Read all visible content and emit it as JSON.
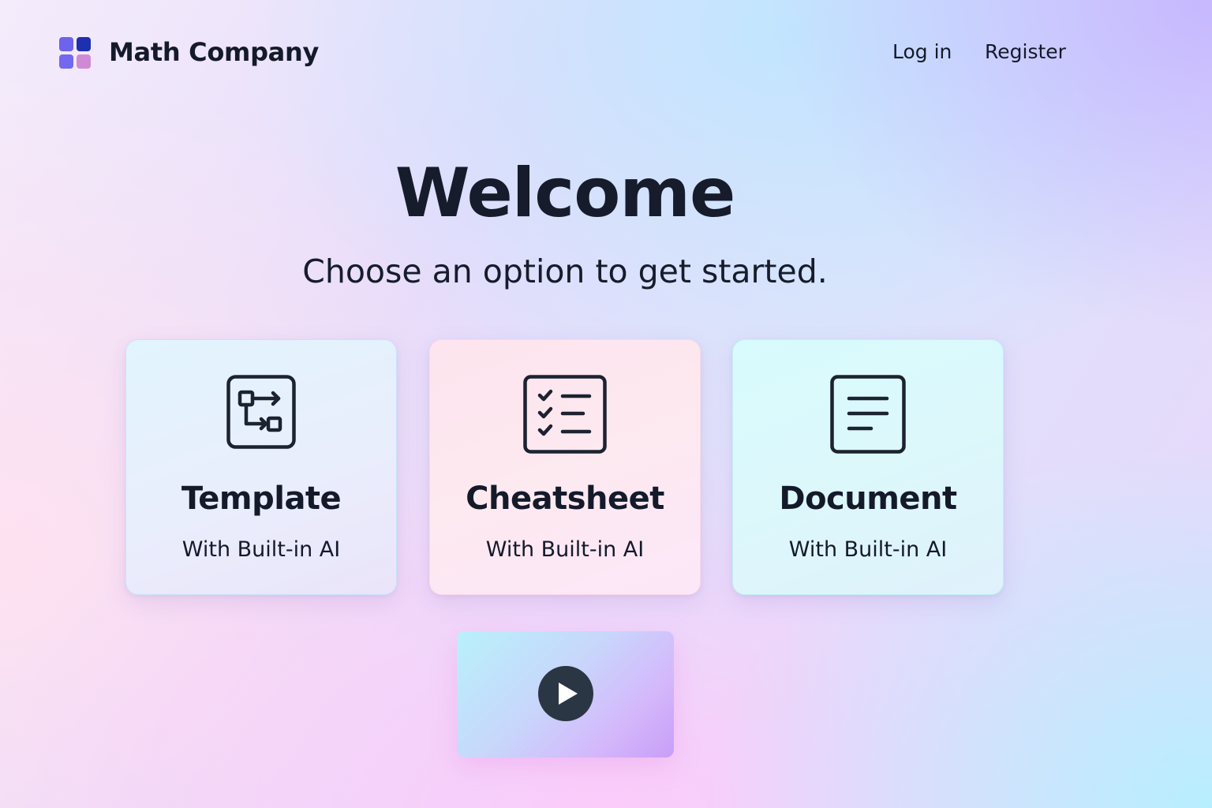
{
  "header": {
    "brand": "Math Company",
    "logo_icon": "grid-logo-icon",
    "logo_colors": [
      "#6d63ec",
      "#1e2fb0",
      "#7368ef",
      "#cf8ad6"
    ],
    "nav": {
      "login": "Log in",
      "register": "Register"
    }
  },
  "hero": {
    "title": "Welcome",
    "subtitle": "Choose an option to get started."
  },
  "cards": [
    {
      "title": "Template",
      "subtitle": "With Built-in AI",
      "icon": "flowchart-icon"
    },
    {
      "title": "Cheatsheet",
      "subtitle": "With Built-in AI",
      "icon": "checklist-icon"
    },
    {
      "title": "Document",
      "subtitle": "With Built-in AI",
      "icon": "document-icon"
    }
  ],
  "video": {
    "icon": "play-icon"
  },
  "colors": {
    "text": "#141a2a",
    "icon_stroke": "#1c2230",
    "play_button": "#2b3644"
  }
}
